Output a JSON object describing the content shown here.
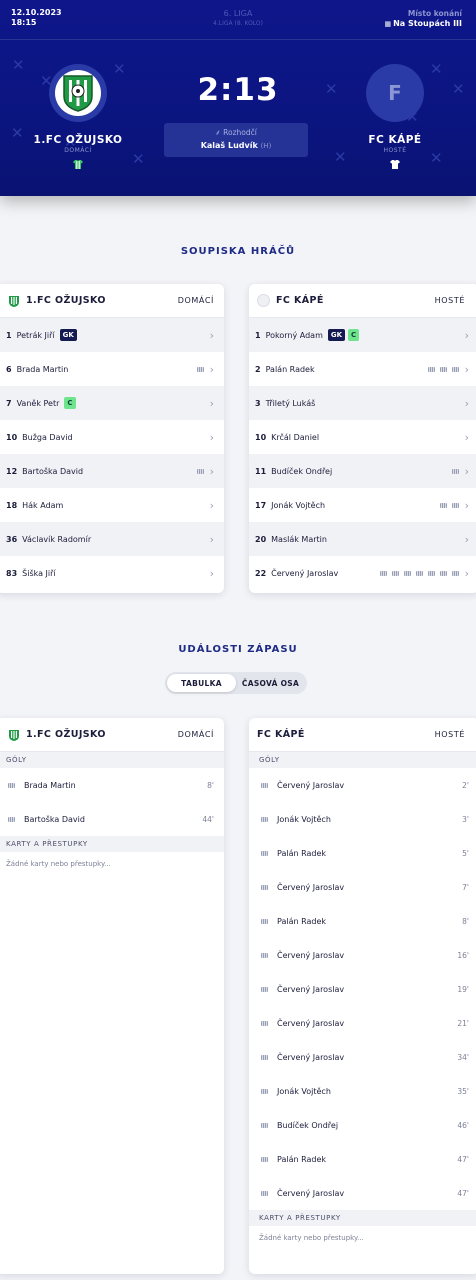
{
  "header": {
    "date": "12.10.2023",
    "time": "18:15",
    "league": "6. LIGA",
    "round": "4.LIGA (8. KOLO)",
    "venue_label": "Místo konání",
    "venue": "Na Stoupách III",
    "score": "2:13",
    "referee_label": "Rozhodčí",
    "referee_name": "Kalaš Ludvík",
    "referee_role": "(H)"
  },
  "home": {
    "name": "1.FC OŽUJSKO",
    "role": "DOMÁCÍ",
    "jersey_color": "#39c766"
  },
  "away": {
    "name": "FC KÁPÉ",
    "role": "HOSTÉ",
    "initial": "F",
    "jersey_color": "#ffffff"
  },
  "roster": {
    "title": "SOUPISKA HRÁČŮ",
    "home_head": {
      "name": "1.FC OŽUJSKO",
      "role": "DOMÁCÍ"
    },
    "away_head": {
      "name": "FC KÁPÉ",
      "role": "HOSTÉ"
    },
    "home": [
      {
        "num": "1",
        "name": "Petrák Jiří",
        "gk": "GK"
      },
      {
        "num": "6",
        "name": "Brada Martin",
        "goals": 1
      },
      {
        "num": "7",
        "name": "Vaněk Petr",
        "c": "C"
      },
      {
        "num": "10",
        "name": "Bužga David"
      },
      {
        "num": "12",
        "name": "Bartoška David",
        "goals": 1
      },
      {
        "num": "18",
        "name": "Hák Adam"
      },
      {
        "num": "36",
        "name": "Václavík Radomír"
      },
      {
        "num": "83",
        "name": "Šiška Jiří"
      }
    ],
    "away": [
      {
        "num": "1",
        "name": "Pokorný Adam",
        "gk": "GK",
        "c": "C"
      },
      {
        "num": "2",
        "name": "Palán Radek",
        "goals": 3
      },
      {
        "num": "3",
        "name": "Třiletý Lukáš"
      },
      {
        "num": "10",
        "name": "Krčál Daniel"
      },
      {
        "num": "11",
        "name": "Budíček Ondřej",
        "goals": 1
      },
      {
        "num": "17",
        "name": "Jonák Vojtěch",
        "goals": 2
      },
      {
        "num": "20",
        "name": "Maslák Martin"
      },
      {
        "num": "22",
        "name": "Červený Jaroslav",
        "goals": 7
      }
    ]
  },
  "events": {
    "title": "UDÁLOSTI ZÁPASU",
    "tabs": [
      "TABULKA",
      "ČASOVÁ OSA"
    ],
    "goals_label": "GÓLY",
    "cards_label": "KARTY A PŘESTUPKY",
    "no_cards": "Žádné karty nebo přestupky...",
    "home": [
      {
        "name": "Brada Martin",
        "min": "8'"
      },
      {
        "name": "Bartoška David",
        "min": "44'"
      }
    ],
    "away": [
      {
        "name": "Červený Jaroslav",
        "min": "2'"
      },
      {
        "name": "Jonák Vojtěch",
        "min": "3'"
      },
      {
        "name": "Palán Radek",
        "min": "5'"
      },
      {
        "name": "Červený Jaroslav",
        "min": "7'"
      },
      {
        "name": "Palán Radek",
        "min": "8'"
      },
      {
        "name": "Červený Jaroslav",
        "min": "16'"
      },
      {
        "name": "Červený Jaroslav",
        "min": "19'"
      },
      {
        "name": "Červený Jaroslav",
        "min": "21'"
      },
      {
        "name": "Červený Jaroslav",
        "min": "34'"
      },
      {
        "name": "Jonák Vojtěch",
        "min": "35'"
      },
      {
        "name": "Budíček Ondřej",
        "min": "46'"
      },
      {
        "name": "Palán Radek",
        "min": "47'"
      },
      {
        "name": "Červený Jaroslav",
        "min": "47'"
      }
    ]
  }
}
